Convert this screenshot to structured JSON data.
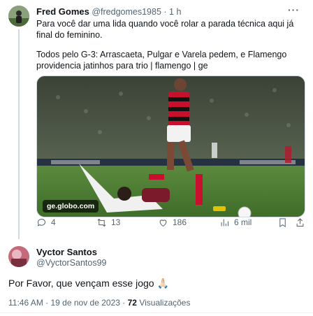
{
  "tweet": {
    "author_name": "Fred Gomes",
    "author_handle": "@fredgomes1985",
    "separator": "·",
    "time": "1 h",
    "more_label": "···",
    "text_line1": "Para você dar uma lida quando você rolar a parada técnica aqui já final do feminino.",
    "text_line2": "Todos pelo G-3: Arrascaeta, Pulgar e Varela pedem, e Flamengo providencia jatinhos para trio | flamengo | ge",
    "media_watermark": "ge.globo.com",
    "actions": {
      "replies": "4",
      "retweets": "13",
      "likes": "186",
      "views": "6 mil"
    }
  },
  "reply": {
    "author_name": "Vyctor Santos",
    "author_handle": "@VyctorSantos99",
    "text": "Por Favor, que vençam esse jogo 🙏🏻",
    "time": "11:46 AM",
    "separator1": "·",
    "date": "19 de nov de 2023",
    "separator2": "·",
    "views_count": "72",
    "views_label": "Visualizações"
  },
  "colors": {
    "text_primary": "#0f1419",
    "text_secondary": "#536471",
    "thread_line": "#cfd9de",
    "jersey_red": "#c8102e",
    "jersey_black": "#111111",
    "pitch_green": "#4f7d36"
  }
}
